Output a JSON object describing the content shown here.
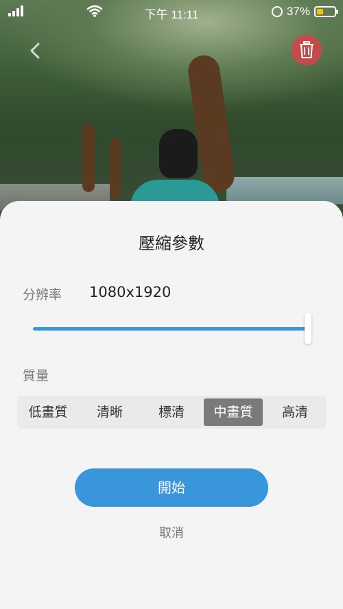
{
  "status_bar": {
    "time": "下午 11:11",
    "battery_percent": "37%",
    "battery_level": 0.37,
    "battery_color": "#f4c20d"
  },
  "top_actions": {
    "back_icon": "chevron-left-icon",
    "delete_icon": "trash-icon",
    "delete_color": "#c64a4a"
  },
  "dialog": {
    "title": "壓縮參數",
    "resolution_label": "分辨率",
    "resolution_value": "1080x1920",
    "resolution_slider_level": 1.0,
    "quality_label": "質量",
    "quality_options": [
      "低畫質",
      "清晰",
      "標清",
      "中畫質",
      "高清"
    ],
    "quality_selected": "中畫質",
    "start_label": "開始",
    "cancel_label": "取消",
    "accent_color": "#3a96db"
  }
}
